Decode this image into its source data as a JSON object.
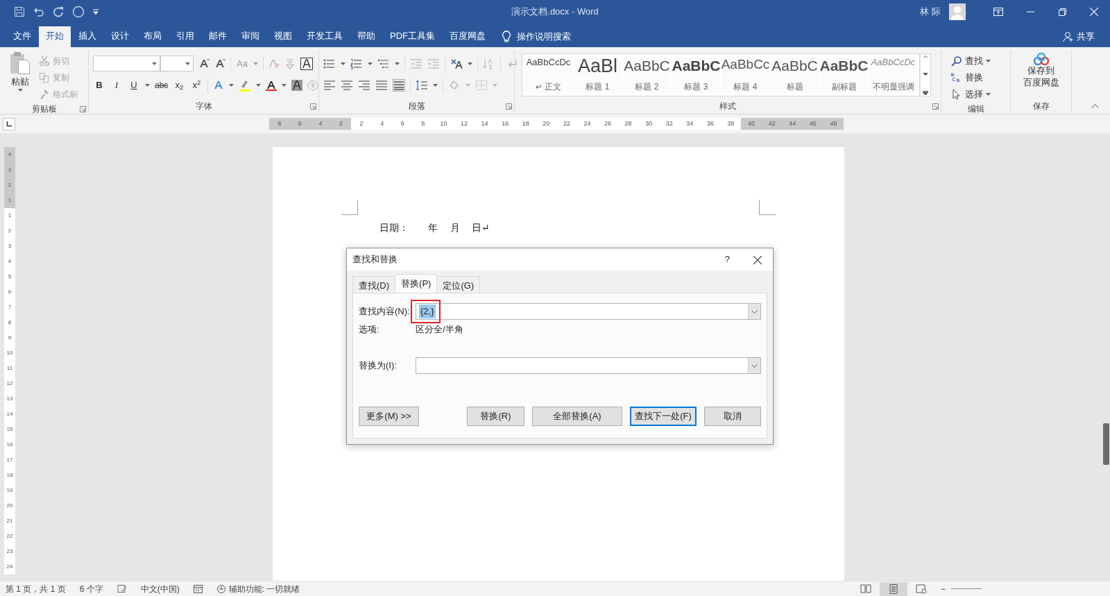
{
  "window": {
    "title": "演示文档.docx - Word",
    "user": "林 际"
  },
  "ribbon_tabs": [
    {
      "label": "文件",
      "selected": false
    },
    {
      "label": "开始",
      "selected": true
    },
    {
      "label": "插入",
      "selected": false
    },
    {
      "label": "设计",
      "selected": false
    },
    {
      "label": "布局",
      "selected": false
    },
    {
      "label": "引用",
      "selected": false
    },
    {
      "label": "邮件",
      "selected": false
    },
    {
      "label": "审阅",
      "selected": false
    },
    {
      "label": "视图",
      "selected": false
    },
    {
      "label": "开发工具",
      "selected": false
    },
    {
      "label": "帮助",
      "selected": false
    },
    {
      "label": "PDF工具集",
      "selected": false
    },
    {
      "label": "百度网盘",
      "selected": false
    }
  ],
  "tell_me": "操作说明搜索",
  "share": "共享",
  "clipboard": {
    "paste": "粘贴",
    "items": [
      {
        "label": "剪切",
        "disabled": true
      },
      {
        "label": "复制",
        "disabled": true
      },
      {
        "label": "格式刷",
        "disabled": true
      }
    ],
    "label": "剪贴板"
  },
  "font": {
    "change_case": "Aa",
    "format_buttons": [
      {
        "kind": "bold",
        "text": "B"
      },
      {
        "kind": "italic",
        "text": "I"
      },
      {
        "kind": "underline",
        "text": "U"
      },
      {
        "kind": "strike",
        "text": "abc"
      },
      {
        "kind": "subscript",
        "text": "x$_{2}$"
      },
      {
        "kind": "superscript",
        "text": "x$^{2}$"
      }
    ],
    "label": "字体"
  },
  "paragraph": {
    "label": "段落"
  },
  "styles": {
    "items": [
      {
        "preview": "AaBbCcDc",
        "name": "↵ 正文",
        "kind": "normal"
      },
      {
        "preview": "AaBl",
        "name": "标题 1",
        "kind": "heading1"
      },
      {
        "preview": "AaBbC",
        "name": "标题 2",
        "kind": "heading2"
      },
      {
        "preview": "AaBbC",
        "name": "标题 3",
        "kind": "heading3"
      },
      {
        "preview": "AaBbCc",
        "name": "标题 4",
        "kind": "heading4"
      },
      {
        "preview": "AaBbC",
        "name": "标题",
        "kind": "title"
      },
      {
        "preview": "AaBbC",
        "name": "副标题",
        "kind": "subtitle"
      },
      {
        "preview": "AaBbCcDc",
        "name": "不明显强调",
        "kind": "subtle"
      }
    ],
    "label": "样式"
  },
  "editing": {
    "items": [
      {
        "label": "查找",
        "dropdown": true
      },
      {
        "label": "替换",
        "dropdown": false
      },
      {
        "label": "选择",
        "dropdown": true
      }
    ],
    "label": "编辑"
  },
  "save": {
    "lines": [
      "保存到",
      "百度网盘"
    ],
    "label": "保存"
  },
  "ruler": [
    {
      "text": "8",
      "margin": true
    },
    {
      "text": "6",
      "margin": true
    },
    {
      "text": "4",
      "margin": true
    },
    {
      "text": "2",
      "margin": true
    },
    {
      "text": "2",
      "margin": false
    },
    {
      "text": "4",
      "margin": false
    },
    {
      "text": "6",
      "margin": false
    },
    {
      "text": "8",
      "margin": false
    },
    {
      "text": "10",
      "margin": false
    },
    {
      "text": "12",
      "margin": false
    },
    {
      "text": "14",
      "margin": false
    },
    {
      "text": "16",
      "margin": false
    },
    {
      "text": "18",
      "margin": false
    },
    {
      "text": "20",
      "margin": false
    },
    {
      "text": "22",
      "margin": false
    },
    {
      "text": "24",
      "margin": false
    },
    {
      "text": "26",
      "margin": false
    },
    {
      "text": "28",
      "margin": false
    },
    {
      "text": "30",
      "margin": false
    },
    {
      "text": "32",
      "margin": false
    },
    {
      "text": "34",
      "margin": false
    },
    {
      "text": "36",
      "margin": false
    },
    {
      "text": "38",
      "margin": false
    },
    {
      "text": "40",
      "margin": true
    },
    {
      "text": "42",
      "margin": true
    },
    {
      "text": "44",
      "margin": true
    },
    {
      "text": "46",
      "margin": true
    },
    {
      "text": "48",
      "margin": true
    }
  ],
  "vertical_ruler": [
    {
      "text": "4",
      "margin": true
    },
    {
      "text": "3",
      "margin": true
    },
    {
      "text": "2",
      "margin": true
    },
    {
      "text": "1",
      "margin": true
    },
    {
      "text": "1",
      "margin": false
    },
    {
      "text": "2",
      "margin": false
    },
    {
      "text": "3",
      "margin": false
    },
    {
      "text": "4",
      "margin": false
    },
    {
      "text": "5",
      "margin": false
    },
    {
      "text": "6",
      "margin": false
    },
    {
      "text": "7",
      "margin": false
    },
    {
      "text": "8",
      "margin": false
    },
    {
      "text": "9",
      "margin": false
    },
    {
      "text": "10",
      "margin": false
    },
    {
      "text": "11",
      "margin": false
    },
    {
      "text": "12",
      "margin": false
    },
    {
      "text": "13",
      "margin": false
    },
    {
      "text": "14",
      "margin": false
    },
    {
      "text": "15",
      "margin": false
    },
    {
      "text": "16",
      "margin": false
    },
    {
      "text": "17",
      "margin": false
    },
    {
      "text": "18",
      "margin": false
    },
    {
      "text": "19",
      "margin": false
    },
    {
      "text": "20",
      "margin": false
    },
    {
      "text": "21",
      "margin": false
    },
    {
      "text": "22",
      "margin": false
    },
    {
      "text": "23",
      "margin": false
    },
    {
      "text": "24",
      "margin": false
    }
  ],
  "document": {
    "text": "日期：        年     月     日↵"
  },
  "dialog": {
    "title": "查找和替换",
    "help": "?",
    "tabs": [
      {
        "label": "查找(D)",
        "selected": false
      },
      {
        "label": "替换(P)",
        "selected": true
      },
      {
        "label": "定位(G)",
        "selected": false
      }
    ],
    "find": {
      "label": "查找内容(N):",
      "value": "{2,}",
      "value_selected": true,
      "annotated": true
    },
    "options": {
      "label": "选项:",
      "value": "区分全/半角"
    },
    "replace": {
      "label": "替换为(I):"
    },
    "buttons": [
      {
        "label": "更多(M) >>",
        "default": false
      },
      {
        "label": "替换(R)",
        "default": false
      },
      {
        "label": "全部替换(A)",
        "default": false
      },
      {
        "label": "查找下一处(F)",
        "default": true
      },
      {
        "label": "取消",
        "default": false
      }
    ]
  },
  "status_bar": {
    "page": "第 1 页，共 1 页",
    "words": "6 个字",
    "language": "中文(中国)",
    "accessibility": "辅助功能: 一切就绪",
    "views": [
      {
        "kind": "read",
        "selected": false
      },
      {
        "kind": "print",
        "selected": true
      },
      {
        "kind": "web",
        "selected": false
      }
    ],
    "zoom_out": "−"
  }
}
